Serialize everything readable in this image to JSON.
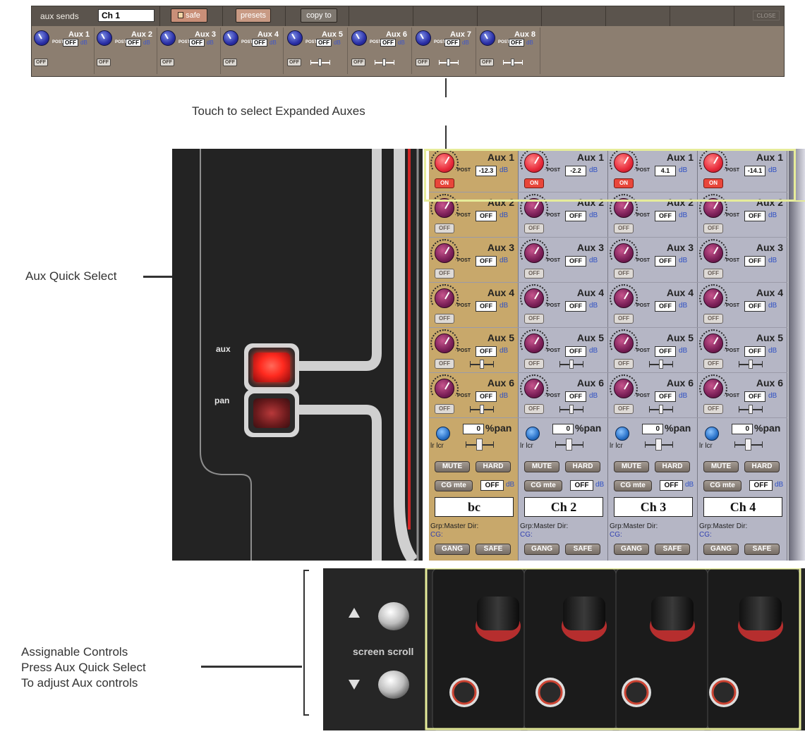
{
  "aux_panel": {
    "title": "aux sends",
    "channel_field": "Ch 1",
    "safe_label": "safe",
    "presets_label": "presets",
    "copy_to_label": "copy to",
    "close_label": "CLOSE",
    "post_label": "POST",
    "db_label": "dB",
    "auxes": [
      {
        "name": "Aux 1",
        "value": "OFF",
        "state": "OFF",
        "fader": false
      },
      {
        "name": "Aux 2",
        "value": "OFF",
        "state": "OFF",
        "fader": false
      },
      {
        "name": "Aux 3",
        "value": "OFF",
        "state": "OFF",
        "fader": false
      },
      {
        "name": "Aux 4",
        "value": "OFF",
        "state": "OFF",
        "fader": false
      },
      {
        "name": "Aux 5",
        "value": "OFF",
        "state": "OFF",
        "fader": true
      },
      {
        "name": "Aux 6",
        "value": "OFF",
        "state": "OFF",
        "fader": true
      },
      {
        "name": "Aux 7",
        "value": "OFF",
        "state": "OFF",
        "fader": true
      },
      {
        "name": "Aux 8",
        "value": "OFF",
        "state": "OFF",
        "fader": true
      }
    ]
  },
  "callouts": {
    "expanded": "Touch to select Expanded Auxes",
    "quick_select": "Aux Quick Select",
    "assign_line1": "Assignable Controls",
    "assign_line2": "Press Aux Quick Select",
    "assign_line3": "To adjust Aux controls"
  },
  "left_photo": {
    "aux_button_label": "aux",
    "pan_button_label": "pan"
  },
  "channel_screen": {
    "post_label": "POST",
    "db_label": "dB",
    "pan_label": "%pan",
    "lr_label": "lr  lcr",
    "mute_label": "MUTE",
    "hard_label": "HARD",
    "cg_mute_label": "CG mte",
    "gang_label": "GANG",
    "safe_label": "SAFE",
    "grp_label": "Grp:Master  Dir:",
    "cg_label": "CG:",
    "strips": [
      {
        "name": "bc",
        "selected": true,
        "pan_value": "0",
        "cg_value": "OFF",
        "auxes": [
          {
            "name": "Aux 1",
            "value": "-12.3",
            "state": "ON",
            "fader": false
          },
          {
            "name": "Aux 2",
            "value": "OFF",
            "state": "OFF",
            "fader": false
          },
          {
            "name": "Aux 3",
            "value": "OFF",
            "state": "OFF",
            "fader": false
          },
          {
            "name": "Aux 4",
            "value": "OFF",
            "state": "OFF",
            "fader": false
          },
          {
            "name": "Aux 5",
            "value": "OFF",
            "state": "OFF",
            "fader": true
          },
          {
            "name": "Aux 6",
            "value": "OFF",
            "state": "OFF",
            "fader": true
          }
        ]
      },
      {
        "name": "Ch 2",
        "selected": false,
        "pan_value": "0",
        "cg_value": "OFF",
        "auxes": [
          {
            "name": "Aux 1",
            "value": "-2.2",
            "state": "ON",
            "fader": false
          },
          {
            "name": "Aux 2",
            "value": "OFF",
            "state": "OFF",
            "fader": false
          },
          {
            "name": "Aux 3",
            "value": "OFF",
            "state": "OFF",
            "fader": false
          },
          {
            "name": "Aux 4",
            "value": "OFF",
            "state": "OFF",
            "fader": false
          },
          {
            "name": "Aux 5",
            "value": "OFF",
            "state": "OFF",
            "fader": true
          },
          {
            "name": "Aux 6",
            "value": "OFF",
            "state": "OFF",
            "fader": true
          }
        ]
      },
      {
        "name": "Ch 3",
        "selected": false,
        "pan_value": "0",
        "cg_value": "OFF",
        "auxes": [
          {
            "name": "Aux 1",
            "value": "4.1",
            "state": "ON",
            "fader": false
          },
          {
            "name": "Aux 2",
            "value": "OFF",
            "state": "OFF",
            "fader": false
          },
          {
            "name": "Aux 3",
            "value": "OFF",
            "state": "OFF",
            "fader": false
          },
          {
            "name": "Aux 4",
            "value": "OFF",
            "state": "OFF",
            "fader": false
          },
          {
            "name": "Aux 5",
            "value": "OFF",
            "state": "OFF",
            "fader": true
          },
          {
            "name": "Aux 6",
            "value": "OFF",
            "state": "OFF",
            "fader": true
          }
        ]
      },
      {
        "name": "Ch 4",
        "selected": false,
        "pan_value": "0",
        "cg_value": "OFF",
        "auxes": [
          {
            "name": "Aux 1",
            "value": "-14.1",
            "state": "ON",
            "fader": false
          },
          {
            "name": "Aux 2",
            "value": "OFF",
            "state": "OFF",
            "fader": false
          },
          {
            "name": "Aux 3",
            "value": "OFF",
            "state": "OFF",
            "fader": false
          },
          {
            "name": "Aux 4",
            "value": "OFF",
            "state": "OFF",
            "fader": false
          },
          {
            "name": "Aux 5",
            "value": "OFF",
            "state": "OFF",
            "fader": true
          },
          {
            "name": "Aux 6",
            "value": "OFF",
            "state": "OFF",
            "fader": true
          }
        ]
      }
    ]
  },
  "bottom_photo": {
    "scroll_label": "screen scroll"
  },
  "colors": {
    "highlight": "#e6ec9a",
    "selected_strip": "#c8a86b",
    "normal_strip": "#b5b6c5",
    "on_button": "#e8463a"
  }
}
